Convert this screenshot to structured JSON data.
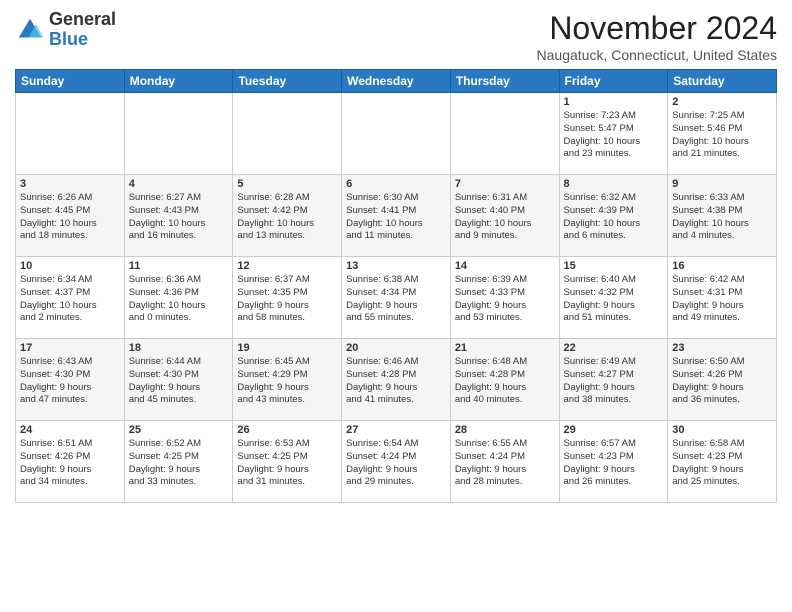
{
  "header": {
    "logo_line1": "General",
    "logo_line2": "Blue",
    "month_title": "November 2024",
    "location": "Naugatuck, Connecticut, United States"
  },
  "days_of_week": [
    "Sunday",
    "Monday",
    "Tuesday",
    "Wednesday",
    "Thursday",
    "Friday",
    "Saturday"
  ],
  "weeks": [
    [
      {
        "day": "",
        "info": ""
      },
      {
        "day": "",
        "info": ""
      },
      {
        "day": "",
        "info": ""
      },
      {
        "day": "",
        "info": ""
      },
      {
        "day": "",
        "info": ""
      },
      {
        "day": "1",
        "info": "Sunrise: 7:23 AM\nSunset: 5:47 PM\nDaylight: 10 hours\nand 23 minutes."
      },
      {
        "day": "2",
        "info": "Sunrise: 7:25 AM\nSunset: 5:46 PM\nDaylight: 10 hours\nand 21 minutes."
      }
    ],
    [
      {
        "day": "3",
        "info": "Sunrise: 6:26 AM\nSunset: 4:45 PM\nDaylight: 10 hours\nand 18 minutes."
      },
      {
        "day": "4",
        "info": "Sunrise: 6:27 AM\nSunset: 4:43 PM\nDaylight: 10 hours\nand 16 minutes."
      },
      {
        "day": "5",
        "info": "Sunrise: 6:28 AM\nSunset: 4:42 PM\nDaylight: 10 hours\nand 13 minutes."
      },
      {
        "day": "6",
        "info": "Sunrise: 6:30 AM\nSunset: 4:41 PM\nDaylight: 10 hours\nand 11 minutes."
      },
      {
        "day": "7",
        "info": "Sunrise: 6:31 AM\nSunset: 4:40 PM\nDaylight: 10 hours\nand 9 minutes."
      },
      {
        "day": "8",
        "info": "Sunrise: 6:32 AM\nSunset: 4:39 PM\nDaylight: 10 hours\nand 6 minutes."
      },
      {
        "day": "9",
        "info": "Sunrise: 6:33 AM\nSunset: 4:38 PM\nDaylight: 10 hours\nand 4 minutes."
      }
    ],
    [
      {
        "day": "10",
        "info": "Sunrise: 6:34 AM\nSunset: 4:37 PM\nDaylight: 10 hours\nand 2 minutes."
      },
      {
        "day": "11",
        "info": "Sunrise: 6:36 AM\nSunset: 4:36 PM\nDaylight: 10 hours\nand 0 minutes."
      },
      {
        "day": "12",
        "info": "Sunrise: 6:37 AM\nSunset: 4:35 PM\nDaylight: 9 hours\nand 58 minutes."
      },
      {
        "day": "13",
        "info": "Sunrise: 6:38 AM\nSunset: 4:34 PM\nDaylight: 9 hours\nand 55 minutes."
      },
      {
        "day": "14",
        "info": "Sunrise: 6:39 AM\nSunset: 4:33 PM\nDaylight: 9 hours\nand 53 minutes."
      },
      {
        "day": "15",
        "info": "Sunrise: 6:40 AM\nSunset: 4:32 PM\nDaylight: 9 hours\nand 51 minutes."
      },
      {
        "day": "16",
        "info": "Sunrise: 6:42 AM\nSunset: 4:31 PM\nDaylight: 9 hours\nand 49 minutes."
      }
    ],
    [
      {
        "day": "17",
        "info": "Sunrise: 6:43 AM\nSunset: 4:30 PM\nDaylight: 9 hours\nand 47 minutes."
      },
      {
        "day": "18",
        "info": "Sunrise: 6:44 AM\nSunset: 4:30 PM\nDaylight: 9 hours\nand 45 minutes."
      },
      {
        "day": "19",
        "info": "Sunrise: 6:45 AM\nSunset: 4:29 PM\nDaylight: 9 hours\nand 43 minutes."
      },
      {
        "day": "20",
        "info": "Sunrise: 6:46 AM\nSunset: 4:28 PM\nDaylight: 9 hours\nand 41 minutes."
      },
      {
        "day": "21",
        "info": "Sunrise: 6:48 AM\nSunset: 4:28 PM\nDaylight: 9 hours\nand 40 minutes."
      },
      {
        "day": "22",
        "info": "Sunrise: 6:49 AM\nSunset: 4:27 PM\nDaylight: 9 hours\nand 38 minutes."
      },
      {
        "day": "23",
        "info": "Sunrise: 6:50 AM\nSunset: 4:26 PM\nDaylight: 9 hours\nand 36 minutes."
      }
    ],
    [
      {
        "day": "24",
        "info": "Sunrise: 6:51 AM\nSunset: 4:26 PM\nDaylight: 9 hours\nand 34 minutes."
      },
      {
        "day": "25",
        "info": "Sunrise: 6:52 AM\nSunset: 4:25 PM\nDaylight: 9 hours\nand 33 minutes."
      },
      {
        "day": "26",
        "info": "Sunrise: 6:53 AM\nSunset: 4:25 PM\nDaylight: 9 hours\nand 31 minutes."
      },
      {
        "day": "27",
        "info": "Sunrise: 6:54 AM\nSunset: 4:24 PM\nDaylight: 9 hours\nand 29 minutes."
      },
      {
        "day": "28",
        "info": "Sunrise: 6:55 AM\nSunset: 4:24 PM\nDaylight: 9 hours\nand 28 minutes."
      },
      {
        "day": "29",
        "info": "Sunrise: 6:57 AM\nSunset: 4:23 PM\nDaylight: 9 hours\nand 26 minutes."
      },
      {
        "day": "30",
        "info": "Sunrise: 6:58 AM\nSunset: 4:23 PM\nDaylight: 9 hours\nand 25 minutes."
      }
    ]
  ]
}
